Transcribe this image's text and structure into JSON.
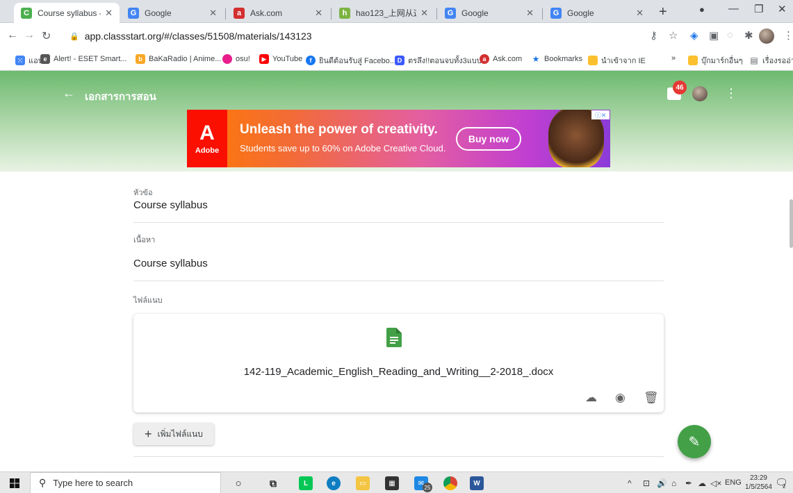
{
  "browser": {
    "tabs": [
      {
        "title": "Course syllabus - เอกส",
        "close": "✕",
        "active": true,
        "fav": "C",
        "fav_color": "#4caf50"
      },
      {
        "title": "Google",
        "close": "✕",
        "active": false,
        "fav": "G",
        "fav_color": "#4285f4"
      },
      {
        "title": "Ask.com",
        "close": "✕",
        "active": false,
        "fav": "a",
        "fav_color": "#d32f2f"
      },
      {
        "title": "hao123_上网从这里开",
        "close": "✕",
        "active": false,
        "fav": "h",
        "fav_color": "#7cb342"
      },
      {
        "title": "Google",
        "close": "✕",
        "active": false,
        "fav": "G",
        "fav_color": "#4285f4"
      },
      {
        "title": "Google",
        "close": "✕",
        "active": false,
        "fav": "G",
        "fav_color": "#4285f4"
      }
    ],
    "url": "app.classstart.org/#/classes/51508/materials/143123",
    "bookmarks": [
      {
        "label": "แอป",
        "color": "#4285f4"
      },
      {
        "label": "Alert! - ESET Smart...",
        "color": "#555555"
      },
      {
        "label": "BaKaRadio | Anime...",
        "color": "#f9a825"
      },
      {
        "label": "osu!",
        "color": "#e91e8c"
      },
      {
        "label": "YouTube",
        "color": "#ff0000"
      },
      {
        "label": "ยินดีต้อนรับสู่ Facebo...",
        "color": "#1877f2"
      },
      {
        "label": "ตรลึง!!ตอนจบทั้ง3แบบ...",
        "color": "#3d5afe"
      },
      {
        "label": "Ask.com",
        "color": "#d32f2f"
      },
      {
        "label": "Bookmarks",
        "color": "#1a73e8"
      },
      {
        "label": "นำเข้าจาก IE",
        "color": "#fbc02d"
      },
      {
        "label": "บุ๊กมาร์กอื่นๆ",
        "color": "#fbc02d"
      },
      {
        "label": "เรื่องรออ่าน",
        "color": "#5f6368"
      }
    ]
  },
  "app": {
    "title": "เอกสารการสอน",
    "notification_count": "46"
  },
  "ad": {
    "brand": "Adobe",
    "headline": "Unleash the power of creativity.",
    "subline": "Students save up to 60% on Adobe Creative Cloud.",
    "cta": "Buy now"
  },
  "material": {
    "topic_label": "หัวข้อ",
    "topic_value": "Course syllabus",
    "content_label": "เนื้อหา",
    "content_value": "Course syllabus",
    "attach_label": "ไฟล์แนบ",
    "file_name": "142-119_Academic_English_Reading_and_Writing__2-2018_.docx",
    "add_attach_label": "เพิ่มไฟล์แนบ"
  },
  "taskbar": {
    "search_placeholder": "Type here to search",
    "mail_badge": "25",
    "lang": "ENG",
    "time": "23:29",
    "date": "1/5/2564",
    "notif_count": "2"
  }
}
